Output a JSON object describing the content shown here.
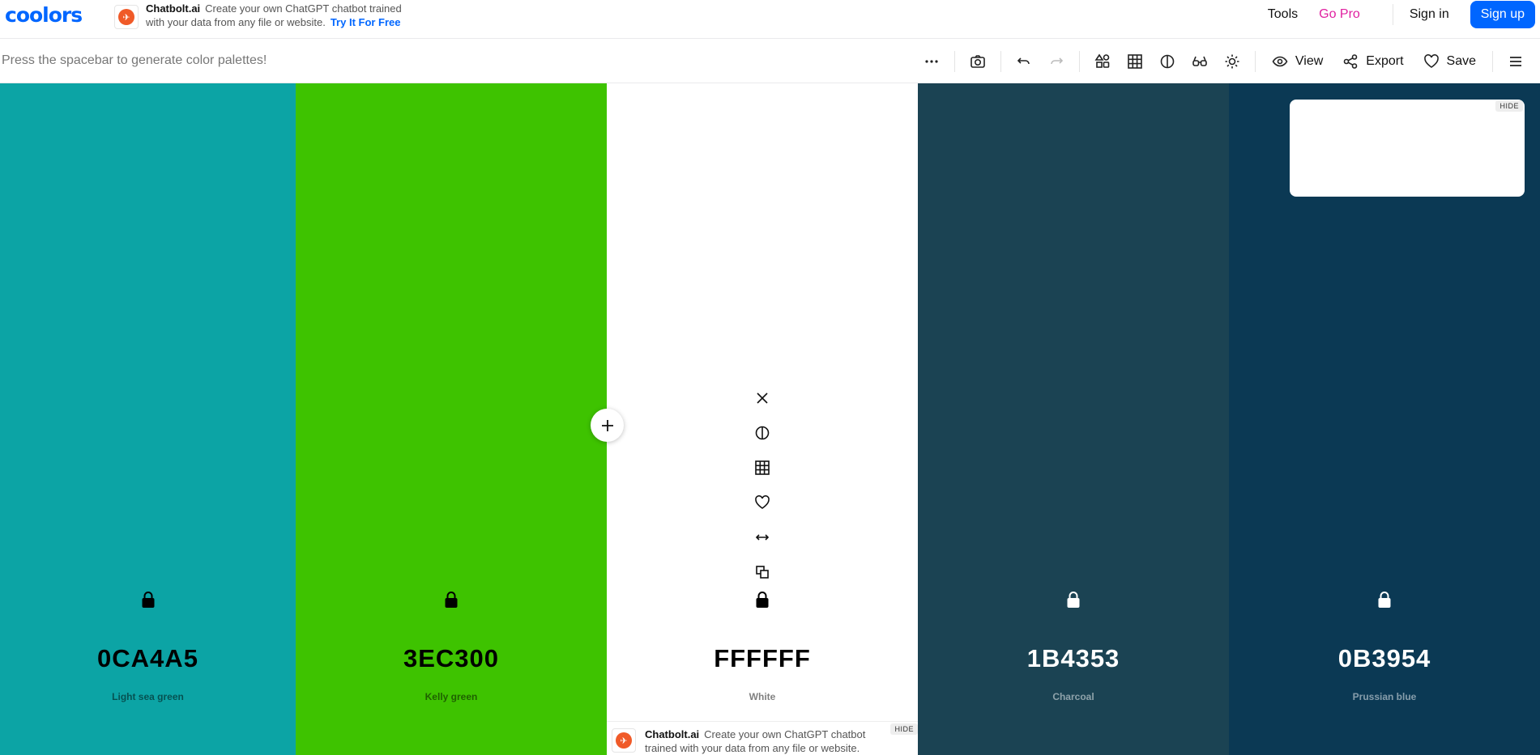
{
  "app": {
    "logo_text": "coolors"
  },
  "ad_top": {
    "brand": "Chatbolt.ai",
    "text": "Create your own ChatGPT chatbot trained with your data from any file or website.",
    "cta": "Try It For Free"
  },
  "nav": {
    "tools": "Tools",
    "go_pro": "Go Pro",
    "sign_in": "Sign in",
    "sign_up": "Sign up"
  },
  "toolbar": {
    "hint": "Press the spacebar to generate color palettes!",
    "view": "View",
    "export": "Export",
    "save": "Save"
  },
  "palette": [
    {
      "hex": "0CA4A5",
      "name": "Light sea green",
      "bg": "#0CA4A5",
      "text_color": "#000000"
    },
    {
      "hex": "3EC300",
      "name": "Kelly green",
      "bg": "#3EC300",
      "text_color": "#000000"
    },
    {
      "hex": "FFFFFF",
      "name": "White",
      "bg": "#FFFFFF",
      "text_color": "#000000"
    },
    {
      "hex": "1B4353",
      "name": "Charcoal",
      "bg": "#1B4353",
      "text_color": "#FFFFFF"
    },
    {
      "hex": "0B3954",
      "name": "Prussian blue",
      "bg": "#0B3954",
      "text_color": "#FFFFFF"
    }
  ],
  "float_ad": {
    "hide": "HIDE"
  },
  "bottom_ad": {
    "brand": "Chatbolt.ai",
    "text": "Create your own ChatGPT chatbot trained with your data from any file or website.",
    "hide": "HIDE"
  },
  "colors": {
    "accent": "#0066ff",
    "pro": "#e020a0"
  }
}
